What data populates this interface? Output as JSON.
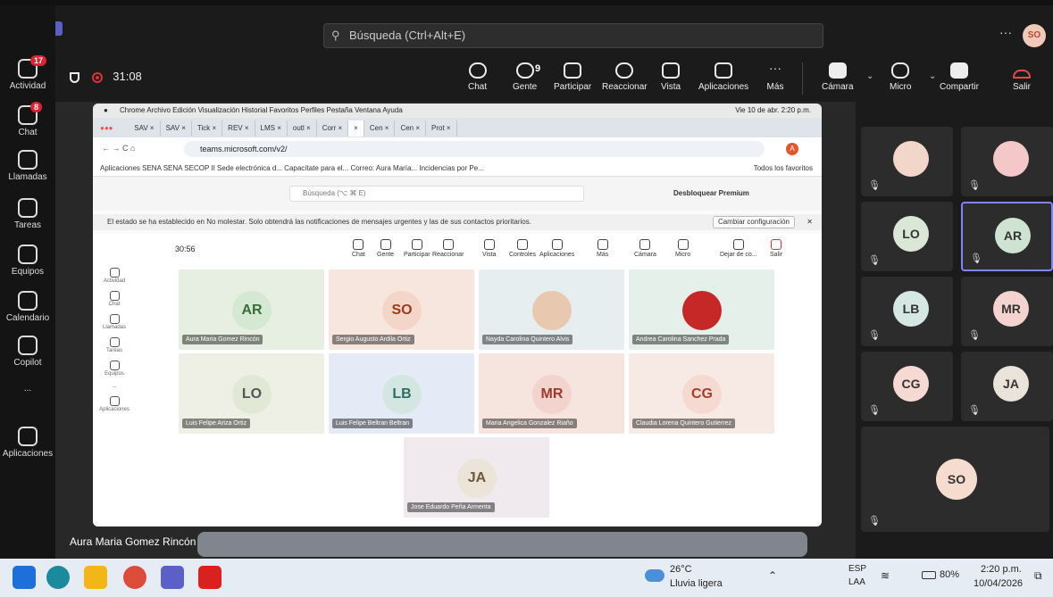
{
  "search": {
    "placeholder": "Búsqueda (Ctrl+Alt+E)"
  },
  "user_initials": "SO",
  "rail": [
    {
      "label": "Actividad",
      "badge": "17"
    },
    {
      "label": "Chat",
      "badge": "8"
    },
    {
      "label": "Llamadas",
      "badge": ""
    },
    {
      "label": "Tareas",
      "badge": ""
    },
    {
      "label": "Equipos",
      "badge": ""
    },
    {
      "label": "Calendario",
      "badge": ""
    },
    {
      "label": "Copilot",
      "badge": ""
    },
    {
      "label": "...",
      "badge": ""
    },
    {
      "label": "Aplicaciones",
      "badge": ""
    }
  ],
  "meeting": {
    "timer": "31:08",
    "buttons": [
      "Chat",
      "Gente",
      "Participar",
      "Reaccionar",
      "Vista",
      "Aplicaciones",
      "Más",
      "Cámara",
      "Micro",
      "Compartir",
      "Salir"
    ],
    "people_count": "9"
  },
  "right_tiles": [
    {
      "initials": "",
      "color": "#f2d6c9"
    },
    {
      "initials": "",
      "color": "#f4c8c8"
    },
    {
      "initials": "LO",
      "color": "#dbe7d6"
    },
    {
      "initials": "AR",
      "color": "#cfe3d2"
    },
    {
      "initials": "LB",
      "color": "#d5e7e3"
    },
    {
      "initials": "MR",
      "color": "#f4d2cf"
    },
    {
      "initials": "CG",
      "color": "#f6d9d2"
    },
    {
      "initials": "JA",
      "color": "#e9e3da"
    },
    {
      "initials": "SO",
      "color": "#f6dccf"
    }
  ],
  "mac": {
    "menubar": "Chrome   Archivo   Edición   Visualización   Historial   Favoritos   Perfiles   Pestaña   Ventana   Ayuda",
    "clock": "Vie 10 de abr.  2:20 p.m.",
    "tabs": [
      "SAV",
      "SAV",
      "Tick",
      "REV",
      "LMS",
      "outl",
      "Corr",
      "",
      "Cen",
      "Cen",
      "Prot"
    ],
    "url": "teams.microsoft.com/v2/",
    "bookmarks": "Aplicaciones   SENA   SENA   SECOP II   Sede electrónica d...   Capacítate para el...   Correo: Aura María...   Incidencias por Pe...",
    "bookmarks_right": "Todos los favoritos",
    "search": "Búsqueda (⌥ ⌘ E)",
    "premium": "Desbloquear Premium",
    "notice": "El estado se ha establecido en No molestar. Solo obtendrá las notificaciones de mensajes urgentes y las de sus contactos prioritarios.",
    "notice_btn": "Cambiar configuración",
    "inner_timer": "30:56",
    "inner_buttons": [
      "Chat",
      "Gente",
      "Participar",
      "Reaccionar",
      "Vista",
      "Controles",
      "Aplicaciones",
      "Más",
      "Cámara",
      "Micro",
      "Dejar de co...",
      "Salir"
    ],
    "inner_rail": [
      "Actividad",
      "Chat",
      "Llamadas",
      "Tareas",
      "Equipos",
      "...",
      "Aplicaciones"
    ],
    "tiles": [
      {
        "initials": "AR",
        "name": "Aura Maria Gomez Rincón",
        "bg": "#e6efe2",
        "fg": "#3b6b3b",
        "ini_bg": "#d5e8d2"
      },
      {
        "initials": "SO",
        "name": "Sergio Augusto Ardila Ortiz",
        "bg": "#f7e6de",
        "fg": "#9b3a1b",
        "ini_bg": "#f4d6c9"
      },
      {
        "initials": "",
        "name": "Nayda Carolina Quintero Alvis",
        "bg": "#e7eef0",
        "fg": "#333",
        "ini_bg": "#e8c9b0"
      },
      {
        "initials": "",
        "name": "Andrea Carolina Sanchez Prada",
        "bg": "#e6f0ea",
        "fg": "#333",
        "ini_bg": "#c62828"
      },
      {
        "initials": "LO",
        "name": "Luis Felipe Ariza Ortiz",
        "bg": "#eef0e6",
        "fg": "#555",
        "ini_bg": "#e2e8d6"
      },
      {
        "initials": "LB",
        "name": "Luis Felipe Beltran Beltran",
        "bg": "#e4ebf6",
        "fg": "#2f6d63",
        "ini_bg": "#d4e6e2"
      },
      {
        "initials": "MR",
        "name": "Maria Angelica Gonzalez Riaño",
        "bg": "#f6e4de",
        "fg": "#9b3a2b",
        "ini_bg": "#f3d3cd"
      },
      {
        "initials": "CG",
        "name": "Claudia Lorena Quintero Gutierrez",
        "bg": "#f7eae4",
        "fg": "#a0402b",
        "ini_bg": "#f6d9d0"
      },
      {
        "initials": "JA",
        "name": "Jose Eduardo Peña Armenta",
        "bg": "#f0e9ee",
        "fg": "#6b5a3a",
        "ini_bg": "#ece4d8"
      }
    ]
  },
  "caption": "Aura Maria Gomez Rincón",
  "taskbar": {
    "weather_temp": "26°C",
    "weather_desc": "Lluvia ligera",
    "lang1": "ESP",
    "lang2": "LAA",
    "battery": "80%",
    "time": "2:20 p.m.",
    "date": "10/04/2026"
  }
}
